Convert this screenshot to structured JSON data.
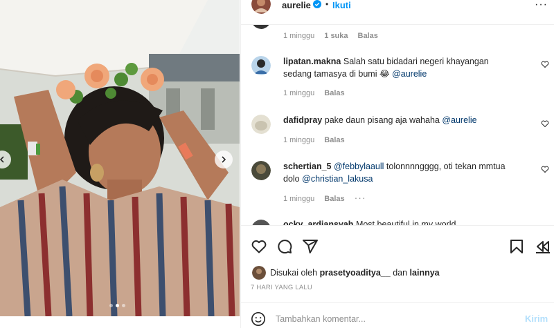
{
  "header": {
    "username": "aurelie",
    "bullet": "•",
    "follow_label": "Ikuti",
    "more_label": "···",
    "avatar_color": "#8a4b3c"
  },
  "comments": [
    {
      "username": "",
      "text": "",
      "time": "1 minggu",
      "likes": "1 suka",
      "reply_label": "Balas",
      "avatar_color": "#333333"
    },
    {
      "username": "lipatan.makna",
      "text": "Salah satu bidadari negeri khayangan sedang tamasya di bumi 😂",
      "mention": "@aurelie",
      "time": "1 minggu",
      "reply_label": "Balas",
      "avatar_color": "#3a6ea8"
    },
    {
      "username": "dafidpray",
      "text": "pake daun pisang aja wahaha",
      "mention": "@aurelie",
      "time": "1 minggu",
      "reply_label": "Balas",
      "avatar_color": "#c9c3b0"
    },
    {
      "username": "schertian_5",
      "mention_first": "@febbylaaull",
      "text": "tolonnnngggg, oti tekan mmtua dolo",
      "mention": "@christian_lakusa",
      "time": "1 minggu",
      "reply_label": "Balas",
      "more": "···",
      "avatar_color": "#4a4a3a"
    },
    {
      "username": "ocky_ardiansyah",
      "text": "Most beautiful in my world",
      "avatar_color": "#555555"
    }
  ],
  "likes": {
    "prefix": "Disukai oleh",
    "user": "prasetyoaditya__",
    "middle": "dan",
    "others": "lainnya",
    "avatar_color": "#6b4f3a"
  },
  "time_ago": "7 HARI YANG LALU",
  "add_comment": {
    "placeholder": "Tambahkan komentar...",
    "post_label": "Kirim"
  },
  "icons": {
    "like": "heart-icon",
    "comment": "comment-icon",
    "share": "share-icon",
    "save": "bookmark-icon",
    "emoji": "emoji-icon",
    "verified": "verified-badge-icon",
    "prev": "chevron-left-icon",
    "next": "chevron-right-icon"
  },
  "colors": {
    "accent": "#0095f6",
    "post_disabled": "#b2dffc",
    "muted": "#8e8e8e",
    "mention": "#00376b"
  },
  "carousel": {
    "total": 3,
    "active_index": 1
  }
}
